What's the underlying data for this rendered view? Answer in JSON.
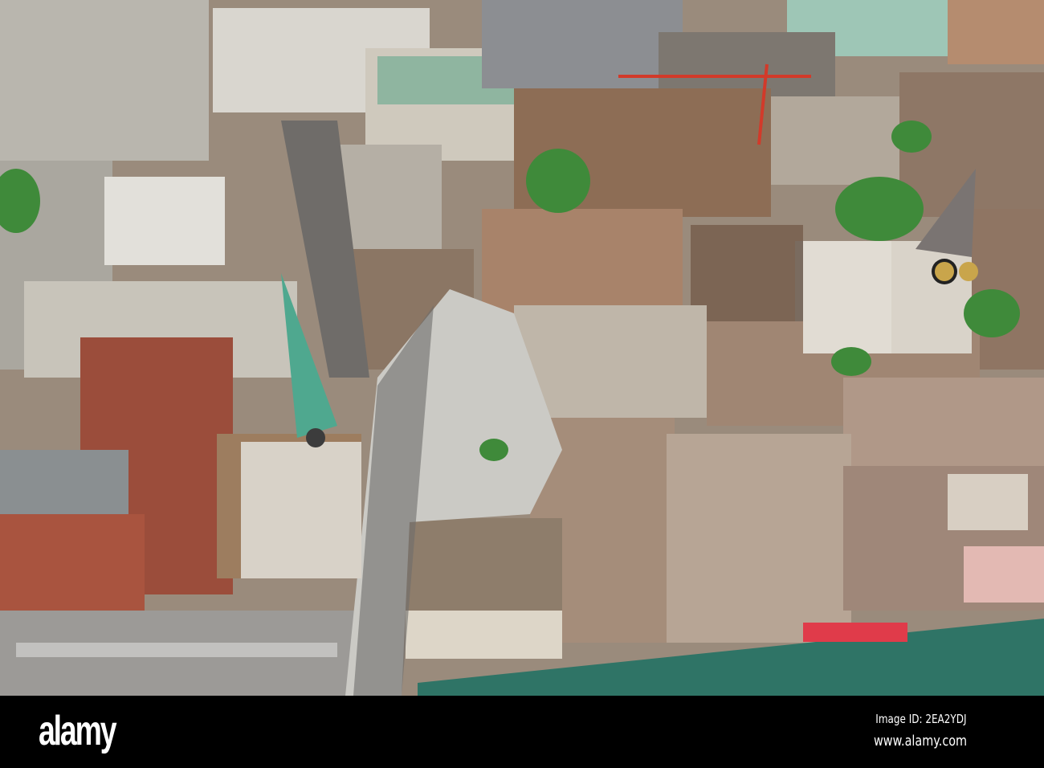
{
  "photo": {
    "subject": "aerial-city-view"
  },
  "footer": {
    "logo": "alamy",
    "image_id": "Image ID: 2EA2YDJ",
    "url": "www.alamy.com"
  },
  "colors": {
    "river": "#2f7466",
    "plaza": "#c9c9c4",
    "roof": "#8a6a52",
    "spire": "#4fa88f"
  }
}
